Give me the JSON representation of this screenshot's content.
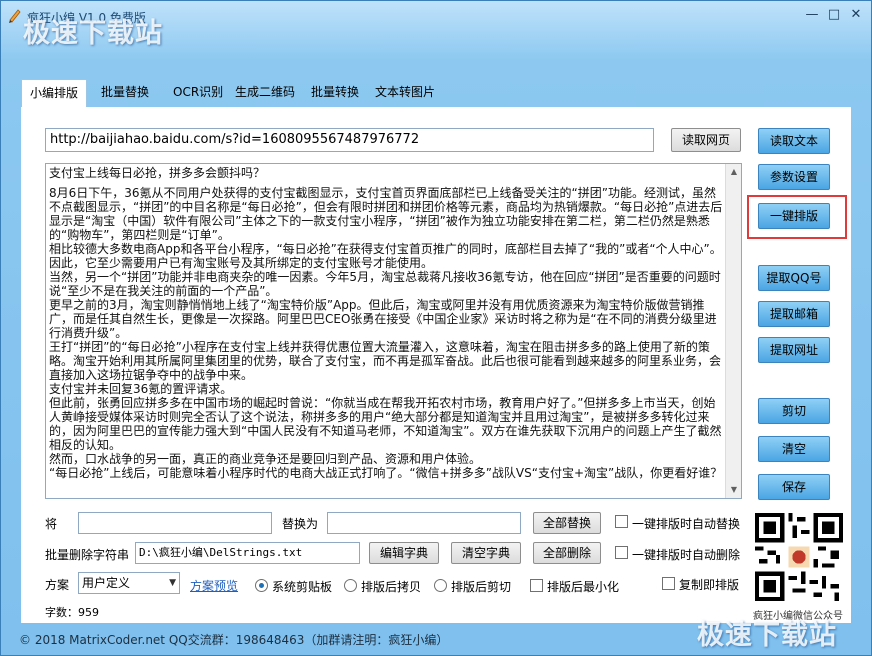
{
  "window": {
    "title": "疯狂小编 V1.0 免费版",
    "watermark_top": "极速下载站",
    "watermark_bottom": "极速下载站",
    "min_glyph": "—",
    "max_glyph": "□",
    "close_glyph": "✕"
  },
  "tabs": [
    {
      "label": "小编排版",
      "active": true
    },
    {
      "label": "批量替换"
    },
    {
      "label": "OCR识别"
    },
    {
      "label": "生成二维码"
    },
    {
      "label": "批量转换"
    },
    {
      "label": "文本转图片"
    }
  ],
  "url": {
    "value": "http://baijiahao.baidu.com/s?id=1608095567487976772",
    "read_page_label": "读取网页"
  },
  "side_buttons": {
    "read_text": "读取文本",
    "params": "参数设置",
    "one_click": "一键排版",
    "extract_qq": "提取QQ号",
    "extract_email": "提取邮箱",
    "extract_url": "提取网址",
    "cut": "剪切",
    "clear": "清空",
    "save": "保存"
  },
  "article": [
    "支付宝上线每日必抢，拼多多会颤抖吗？",
    "8月6日下午，36氪从不同用户处获得的支付宝截图显示，支付宝首页界面底部栏已上线备受关注的“拼团”功能。经测试，虽然不点截图显示，“拼团”的中目名称是“每日必抢”，但会有限时拼团和拼团价格等元素，商品均为热销爆款。“每日必抢”点进去后显示是“淘宝（中国）软件有限公司”主体之下的一款支付宝小程序，“拼团”被作为独立功能安排在第二栏，第二栏仍然是熟悉的“购物车”，第四栏则是“订单”。",
    "相比较德大多数电商App和各平台小程序，“每日必抢”在获得支付宝首页推广的同时，底部栏目去掉了“我的”或者“个人中心”。因此，它至少需要用户已有淘宝账号及其所绑定的支付宝账号才能使用。",
    "当然，另一个“拼团”功能并非电商夹杂的唯一因素。今年5月，淘宝总裁蒋凡接收36氪专访，他在回应“拼团”是否重要的问题时说“至少不是在我关注的前面的一个产品”。",
    "更早之前的3月，淘宝则静悄悄地上线了“淘宝特价版”App。但此后，淘宝或阿里并没有用优质资源来为淘宝特价版做营销推广，而是任其自然生长，更像是一次探路。阿里巴巴CEO张勇在接受《中国企业家》采访时将之称为是“在不同的消费分级里进行消费升级”。",
    "王打“拼团”的“每日必抢”小程序在支付宝上线并获得优惠位置大流量灌入，这意味着，淘宝在阻击拼多多的路上使用了新的策略。淘宝开始利用其所属阿里集团里的优势，联合了支付宝，而不再是孤军奋战。此后也很可能看到越来越多的阿里系业务，会直接加入这场拉锯争夺中的战争中来。",
    "支付宝并未回复36氪的置评请求。",
    "但此前，张勇回应拼多多在中国市场的崛起时曾说：“你就当成在帮我开拓农村市场，教育用户好了。”但拼多多上市当天，创始人黄峥接受媒体采访时则完全否认了这个说法，称拼多多的用户“绝大部分都是知道淘宝并且用过淘宝”，是被拼多多转化过来的，因为阿里巴巴的宣传能力强大到“中国人民没有不知道马老师，不知道淘宝”。双方在谁先获取下沉用户的问题上产生了截然相反的认知。",
    "然而，口水战争的另一面，真正的商业竞争还是要回归到产品、资源和用户体验。",
    "“每日必抢”上线后，可能意味着小程序时代的电商大战正式打响了。“微信+拼多多”战队VS“支付宝+淘宝”战队，你更看好谁？"
  ],
  "replace": {
    "from_label": "将",
    "to_label": "替换为",
    "from_value": "",
    "to_value": "",
    "replace_all": "全部替换",
    "auto_replace": "一键排版时自动替换"
  },
  "batch_delete": {
    "label": "批量删除字符串",
    "path": "D:\\疯狂小编\\DelStrings.txt",
    "edit_dict": "编辑字典",
    "clear_dict": "清空字典",
    "delete_all": "全部删除",
    "auto_delete": "一键排版时自动删除"
  },
  "scheme": {
    "label": "方案",
    "selected": "用户定义",
    "preview": "方案预览",
    "opt_clipboard": "系统剪贴板",
    "opt_copy_after": "排版后拷贝",
    "opt_cut_after": "排版后剪切",
    "opt_minimize": "排版后最小化",
    "opt_copy_instant": "复制即排版"
  },
  "count": "字数：959",
  "qr_caption": "疯狂小编微信公众号",
  "status": "© 2018 MatrixCoder.net    QQ交流群：198648463（加群请注明：疯狂小编）",
  "colors": {
    "accent": "#4aa5e3",
    "highlight": "#e03a3a",
    "window_bg": "#8cc8f0"
  }
}
